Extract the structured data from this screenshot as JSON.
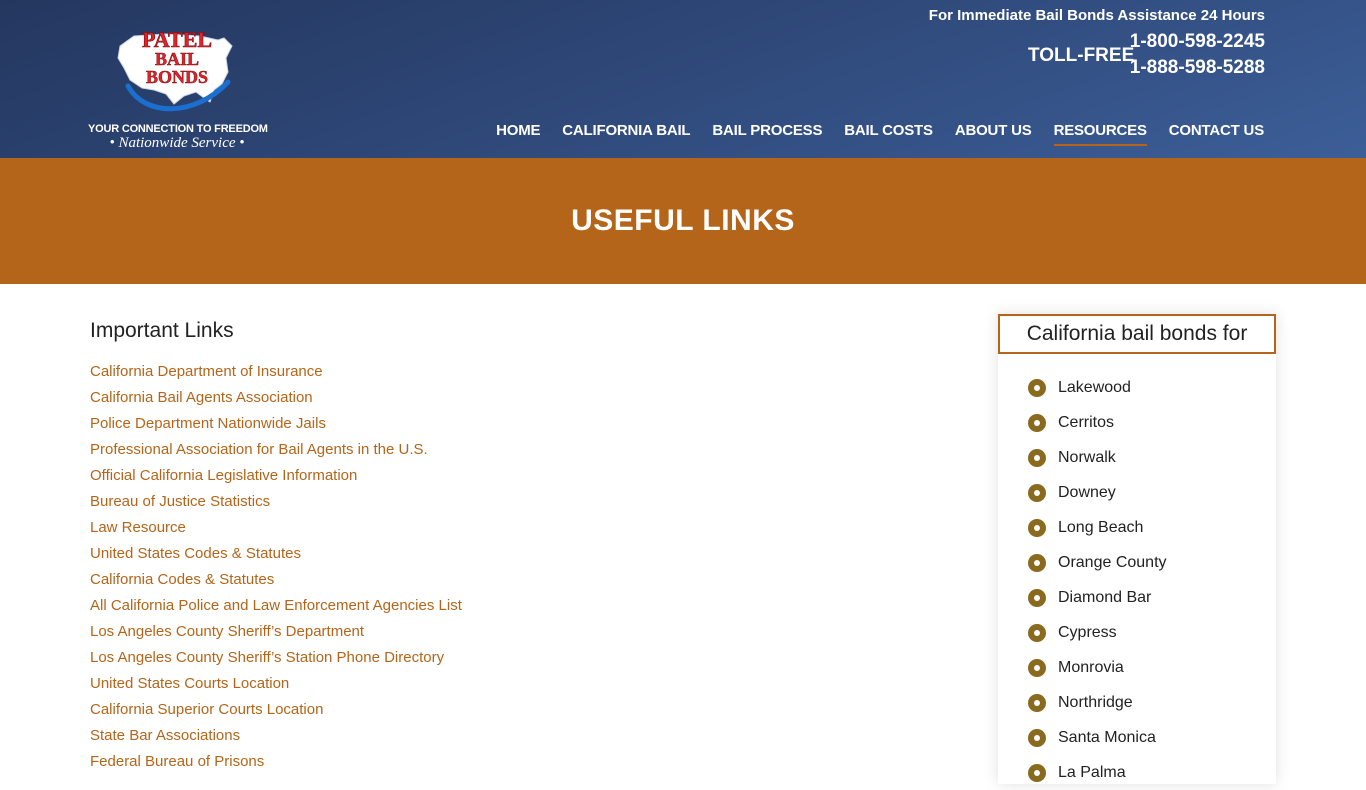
{
  "header": {
    "logo": {
      "line1": "PATEL",
      "line2": "BAIL",
      "line3": "BONDS",
      "tagline": "YOUR CONNECTION TO FREEDOM",
      "subtagline": "• Nationwide Service •"
    },
    "assistance_text": "For Immediate Bail Bonds Assistance 24 Hours",
    "tollfree_label": "TOLL-FREE",
    "phone_1": "1-800-598-2245",
    "phone_2": "1-888-598-5288"
  },
  "nav": {
    "items": [
      {
        "label": "HOME"
      },
      {
        "label": "CALIFORNIA BAIL"
      },
      {
        "label": "BAIL PROCESS"
      },
      {
        "label": "BAIL COSTS"
      },
      {
        "label": "ABOUT US"
      },
      {
        "label": "RESOURCES"
      },
      {
        "label": "CONTACT US"
      }
    ],
    "active": "RESOURCES"
  },
  "banner": {
    "title": "USEFUL LINKS"
  },
  "main": {
    "heading": "Important Links",
    "links": [
      "California Department of Insurance",
      "California Bail Agents Association",
      "Police Department Nationwide Jails",
      "Professional Association for Bail Agents in the U.S.",
      "Official California Legislative Information",
      "Bureau of Justice Statistics",
      "Law Resource",
      "United States Codes & Statutes",
      "California Codes & Statutes",
      "All California Police and Law Enforcement Agencies List",
      "Los Angeles County Sheriff’s Department",
      "Los Angeles County Sheriff’s Station Phone Directory",
      "United States Courts Location",
      "California Superior Courts Location",
      "State Bar Associations",
      "Federal Bureau of Prisons"
    ]
  },
  "sidebar": {
    "title": "California bail bonds for",
    "cities": [
      "Lakewood",
      "Cerritos",
      "Norwalk",
      "Downey",
      "Long Beach",
      "Orange County",
      "Diamond Bar",
      "Cypress",
      "Monrovia",
      "Northridge",
      "Santa Monica",
      "La Palma"
    ]
  },
  "colors": {
    "header_dark": "#24375f",
    "header_light": "#3c5e98",
    "accent_orange": "#b5651a",
    "bullet_gold": "#8a6a1f",
    "logo_red": "#e2232a"
  }
}
